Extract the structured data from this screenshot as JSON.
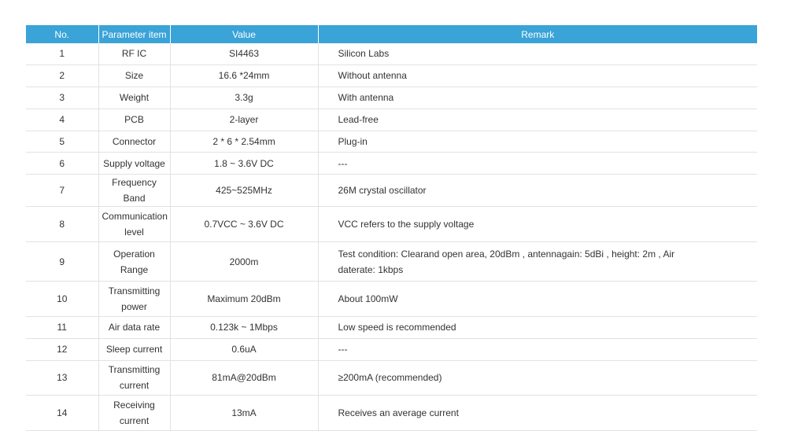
{
  "table": {
    "headers": [
      "No.",
      "Parameter item",
      "Value",
      "Remark"
    ],
    "rows": [
      {
        "no": "1",
        "item": "RF IC",
        "value": "SI4463",
        "remark": "Silicon Labs"
      },
      {
        "no": "2",
        "item": "Size",
        "value": "16.6 *24mm",
        "remark": "Without antenna"
      },
      {
        "no": "3",
        "item": "Weight",
        "value": "3.3g",
        "remark": "With antenna"
      },
      {
        "no": "4",
        "item": "PCB",
        "value": "2-layer",
        "remark": "Lead-free"
      },
      {
        "no": "5",
        "item": "Connector",
        "value": "2 * 6 * 2.54mm",
        "remark": "Plug-in"
      },
      {
        "no": "6",
        "item": "Supply voltage",
        "value": "1.8 ~ 3.6V DC",
        "remark": "---"
      },
      {
        "no": "7",
        "item": "Frequency Band",
        "value": "425~525MHz",
        "remark": "26M crystal oscillator"
      },
      {
        "no": "8",
        "item": "Communication level",
        "value": "0.7VCC ~ 3.6V DC",
        "remark": "VCC refers to the supply voltage"
      },
      {
        "no": "9",
        "item": "Operation Range",
        "value": "2000m",
        "remark": "Test condition: Clearand open area, 20dBm , antennagain: 5dBi , height: 2m , Air daterate: 1kbps"
      },
      {
        "no": "10",
        "item": "Transmitting power",
        "value": "Maximum 20dBm",
        "remark": "About 100mW"
      },
      {
        "no": "11",
        "item": "Air data rate",
        "value": "0.123k ~ 1Mbps",
        "remark": "Low speed is recommended"
      },
      {
        "no": "12",
        "item": "Sleep current",
        "value": "0.6uA",
        "remark": "---"
      },
      {
        "no": "13",
        "item": "Transmitting current",
        "value": "81mA@20dBm",
        "remark": "≥200mA (recommended)"
      },
      {
        "no": "14",
        "item": "Receiving current",
        "value": "13mA",
        "remark": "Receives an average current"
      }
    ]
  },
  "colors": {
    "header_bg": "#3aa3d8",
    "header_text": "#ffffff",
    "grid_line": "#e2e2e2",
    "body_text": "#333333"
  }
}
